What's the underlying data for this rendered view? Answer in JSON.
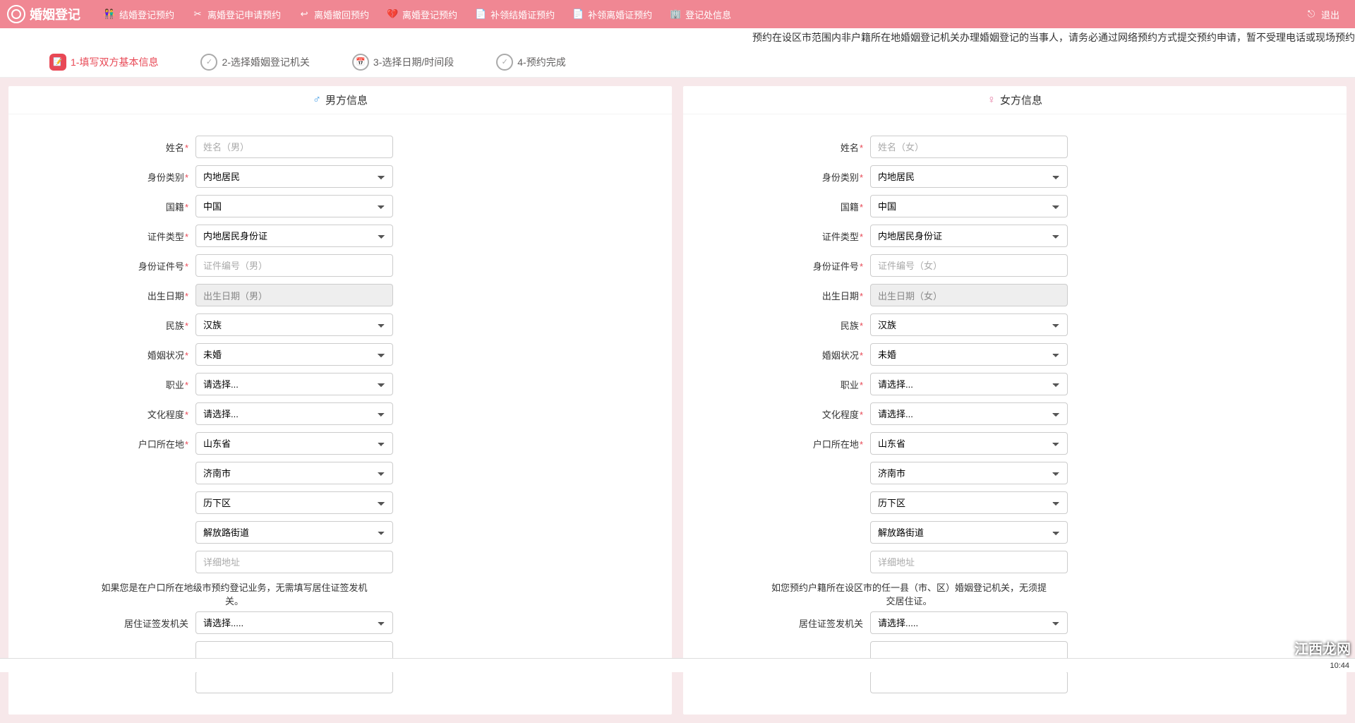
{
  "app": {
    "title": "婚姻登记"
  },
  "nav": {
    "items": [
      {
        "label": "结婚登记预约"
      },
      {
        "label": "离婚登记申请预约"
      },
      {
        "label": "离婚撤回预约"
      },
      {
        "label": "离婚登记预约"
      },
      {
        "label": "补领结婚证预约"
      },
      {
        "label": "补领离婚证预约"
      },
      {
        "label": "登记处信息"
      }
    ],
    "logout": "退出"
  },
  "notice": "预约在设区市范围内非户籍所在地婚姻登记机关办理婚姻登记的当事人，请务必通过网络预约方式提交预约申请，暂不受理电话或现场预约",
  "steps": [
    {
      "label": "1-填写双方基本信息"
    },
    {
      "label": "2-选择婚姻登记机关"
    },
    {
      "label": "3-选择日期/时间段"
    },
    {
      "label": "4-预约完成"
    }
  ],
  "labels": {
    "name": "姓名",
    "id_type": "身份类别",
    "nationality": "国籍",
    "cert_type": "证件类型",
    "id_number": "身份证件号",
    "birth": "出生日期",
    "ethnic": "民族",
    "marital": "婚姻状况",
    "occupation": "职业",
    "education": "文化程度",
    "household": "户口所在地",
    "residence_permit": "居住证签发机关"
  },
  "male": {
    "title": "男方信息",
    "placeholders": {
      "name": "姓名（男）",
      "id_number": "证件编号（男）",
      "birth": "出生日期（男）",
      "address_detail": "详细地址"
    },
    "values": {
      "id_type": "内地居民",
      "nationality": "中国",
      "cert_type": "内地居民身份证",
      "ethnic": "汉族",
      "marital": "未婚",
      "occupation": "请选择...",
      "education": "请选择...",
      "province": "山东省",
      "city": "济南市",
      "district": "历下区",
      "street": "解放路街道",
      "residence_permit": "请选择....."
    },
    "hint": "如果您是在户口所在地级市预约登记业务，无需填写居住证签发机关。"
  },
  "female": {
    "title": "女方信息",
    "placeholders": {
      "name": "姓名（女）",
      "id_number": "证件编号（女）",
      "birth": "出生日期（女）",
      "address_detail": "详细地址"
    },
    "values": {
      "id_type": "内地居民",
      "nationality": "中国",
      "cert_type": "内地居民身份证",
      "ethnic": "汉族",
      "marital": "未婚",
      "occupation": "请选择...",
      "education": "请选择...",
      "province": "山东省",
      "city": "济南市",
      "district": "历下区",
      "street": "解放路街道",
      "residence_permit": "请选择....."
    },
    "hint": "如您预约户籍所在设区市的任一县（市、区）婚姻登记机关，无须提交居住证。"
  },
  "watermark": "江西龙网",
  "taskbar": {
    "time": "10:44"
  }
}
